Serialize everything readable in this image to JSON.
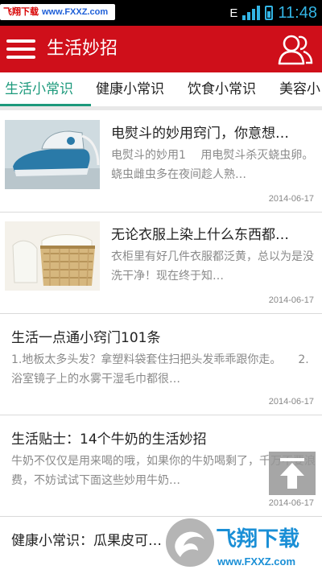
{
  "status_bar": {
    "watermark_brand": "飞翔下载",
    "watermark_url": "www.FXXZ.com",
    "network": "E",
    "time": "11:48"
  },
  "app_bar": {
    "title": "生活妙招",
    "menu_icon": "hamburger-menu-icon",
    "user_icon": "users-icon",
    "background_color": "#cf0f1a"
  },
  "tabs": [
    {
      "label": "生活小常识",
      "active": true
    },
    {
      "label": "健康小常识",
      "active": false
    },
    {
      "label": "饮食小常识",
      "active": false
    },
    {
      "label": "美容小",
      "active": false
    }
  ],
  "tab_active_color": "#1d9a7c",
  "articles": [
    {
      "title": "电熨斗的妙用窍门，你意想…",
      "desc": "电熨斗的妙用1　 用电熨斗杀灭蛲虫卵。蛲虫雌虫多在夜间趁人熟…",
      "date": "2014-06-17",
      "thumb": "iron"
    },
    {
      "title": "无论衣服上染上什么东西都…",
      "desc": "衣柜里有好几件衣服都泛黄，总以为是没洗干净！现在终于知…",
      "date": "2014-06-17",
      "thumb": "laundry-basket"
    },
    {
      "title": "生活一点通小窍门101条",
      "desc": "1.地板太多头发？拿塑料袋套住扫把头发乖乖跟你走。　　2.浴室镜子上的水雾干湿毛巾都很…",
      "date": "2014-06-17"
    },
    {
      "title": "生活贴士：14个牛奶的生活妙招",
      "desc": "牛奶不仅仅是用来喝的哦，如果你的牛奶喝剩了，千万不要浪费，不妨试试下面这些妙用牛奶…",
      "date": "2014-06-17"
    },
    {
      "title": "健康小常识：瓜果皮可…",
      "desc": "",
      "date": ""
    }
  ],
  "overlays": {
    "back_to_top_icon": "arrow-up-icon",
    "bottom_watermark_brand": "飞翔下载",
    "bottom_watermark_url": "www.FXXZ.com"
  }
}
